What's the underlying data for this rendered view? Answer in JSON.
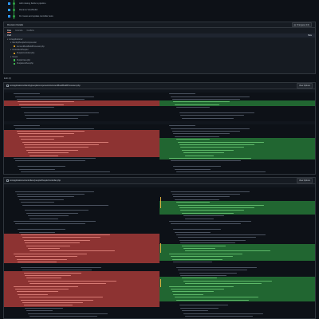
{
  "commits": [
    {
      "msg": "Add missing fields to pipeline",
      "meta": ""
    },
    {
      "msg": "Rename ViewModel",
      "meta": ""
    },
    {
      "msg": "Fix routes and update controller tests",
      "meta": ""
    }
  ],
  "revision": {
    "title": "Revision Details",
    "changeset_button": "Changeset Info",
    "tabs": [
      "Files",
      "Commits",
      "Conflicts"
    ],
    "list_header": {
      "left": "Path",
      "right": "Size"
    },
    "files": [
      {
        "path": "src/applications/",
        "size": "",
        "kind": "folder",
        "indent": 0
      },
      {
        "path": "Identity/People/Components/",
        "size": "",
        "kind": "folder",
        "indent": 1
      },
      {
        "path": "AccountBookBuildProcessor.php",
        "size": "",
        "kind": "mod",
        "indent": 2
      },
      {
        "path": "Controllers/People/",
        "size": "",
        "kind": "folder",
        "indent": 1
      },
      {
        "path": "PeopleController.php",
        "size": "",
        "kind": "mod",
        "indent": 2
      },
      {
        "path": "Views/",
        "size": "",
        "kind": "folder",
        "indent": 1
      },
      {
        "path": "PeopleView.php",
        "size": "",
        "kind": "add",
        "indent": 2
      },
      {
        "path": "PeopleListView.php",
        "size": "",
        "kind": "add",
        "indent": 2
      }
    ]
  },
  "edit_label": "Edit (2)",
  "diff1": {
    "path": "src/applications/identity/people/components/AccountBookBuildProcessor.php",
    "button": "View Options",
    "separators": [
      "",
      ""
    ]
  },
  "diff2": {
    "path": "src/applications/controllers/people/PeopleController.php",
    "button": "View Options",
    "separator": ""
  },
  "colors": {
    "added": "#2ea043",
    "removed": "#f85149",
    "accent": "#1f6feb",
    "highlight": "#e3b341"
  }
}
